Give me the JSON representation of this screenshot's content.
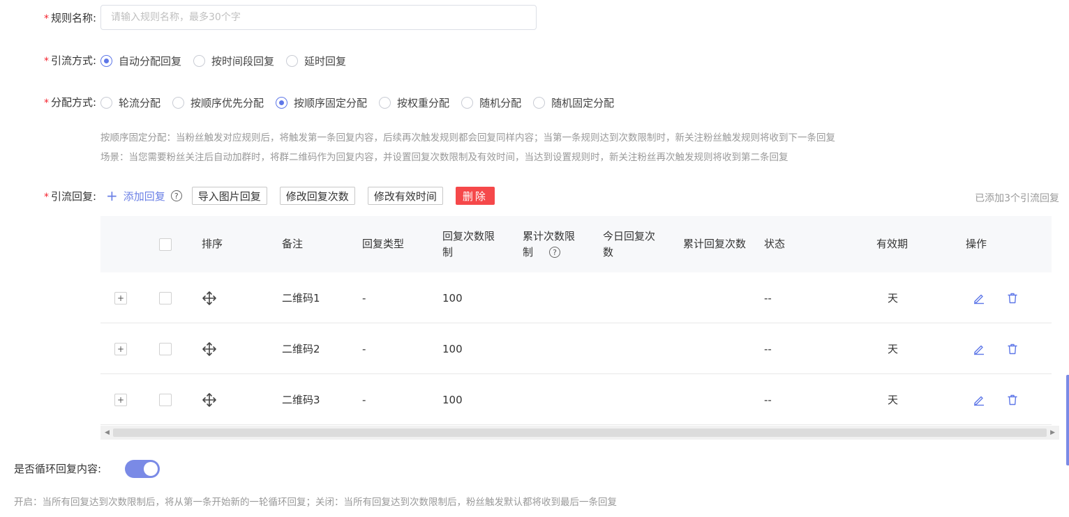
{
  "form": {
    "rule_name": {
      "label": "规则名称:",
      "required": "*",
      "value": "",
      "placeholder": "请输入规则名称，最多30个字"
    },
    "flow_mode": {
      "label": "引流方式:",
      "required": "*",
      "options": [
        {
          "label": "自动分配回复",
          "checked": true
        },
        {
          "label": "按时间段回复",
          "checked": false
        },
        {
          "label": "延时回复",
          "checked": false
        }
      ]
    },
    "assign_mode": {
      "label": "分配方式:",
      "required": "*",
      "options": [
        {
          "label": "轮流分配",
          "checked": false
        },
        {
          "label": "按顺序优先分配",
          "checked": false
        },
        {
          "label": "按顺序固定分配",
          "checked": true
        },
        {
          "label": "按权重分配",
          "checked": false
        },
        {
          "label": "随机分配",
          "checked": false
        },
        {
          "label": "随机固定分配",
          "checked": false
        }
      ],
      "desc_1": "按顺序固定分配：当粉丝触发对应规则后，将触发第一条回复内容，后续再次触发规则都会回复同样内容；当第一条规则达到次数限制时，新关注粉丝触发规则将收到下一条回复",
      "desc_2": "场景：当您需要粉丝关注后自动加群时，将群二维码作为回复内容，并设置回复次数限制及有效时间，当达到设置规则时，新关注粉丝再次触发规则将收到第二条回复"
    },
    "flow_reply": {
      "label": "引流回复:",
      "required": "*",
      "add_label": "添加回复",
      "help_icon": "?",
      "buttons": {
        "import_image": "导入图片回复",
        "edit_count": "修改回复次数",
        "edit_time": "修改有效时间",
        "delete": "删除"
      },
      "added_count_text": "已添加3个引流回复"
    }
  },
  "table": {
    "columns": {
      "sort": "排序",
      "remark": "备注",
      "reply_type": "回复类型",
      "reply_limit": "回复次数限制",
      "cumulative_limit": "累计次数限制",
      "today_count": "今日回复次数",
      "cumulative_count": "累计回复次数",
      "status": "状态",
      "validity": "有效期",
      "actions": "操作"
    },
    "rows": [
      {
        "remark": "二维码1",
        "reply_type": "-",
        "reply_limit": "100",
        "status": "--",
        "validity": "天"
      },
      {
        "remark": "二维码2",
        "reply_type": "-",
        "reply_limit": "100",
        "status": "--",
        "validity": "天"
      },
      {
        "remark": "二维码3",
        "reply_type": "-",
        "reply_limit": "100",
        "status": "--",
        "validity": "天"
      }
    ]
  },
  "loop": {
    "label": "是否循环回复内容:",
    "enabled": true,
    "desc": "开启：当所有回复达到次数限制后，将从第一条开始新的一轮循环回复；关闭：当所有回复达到次数限制后，粉丝触发默认都将收到最后一条回复"
  },
  "colors": {
    "accent": "#5e77e8",
    "danger": "#f5484a",
    "required": "#f5222d"
  }
}
